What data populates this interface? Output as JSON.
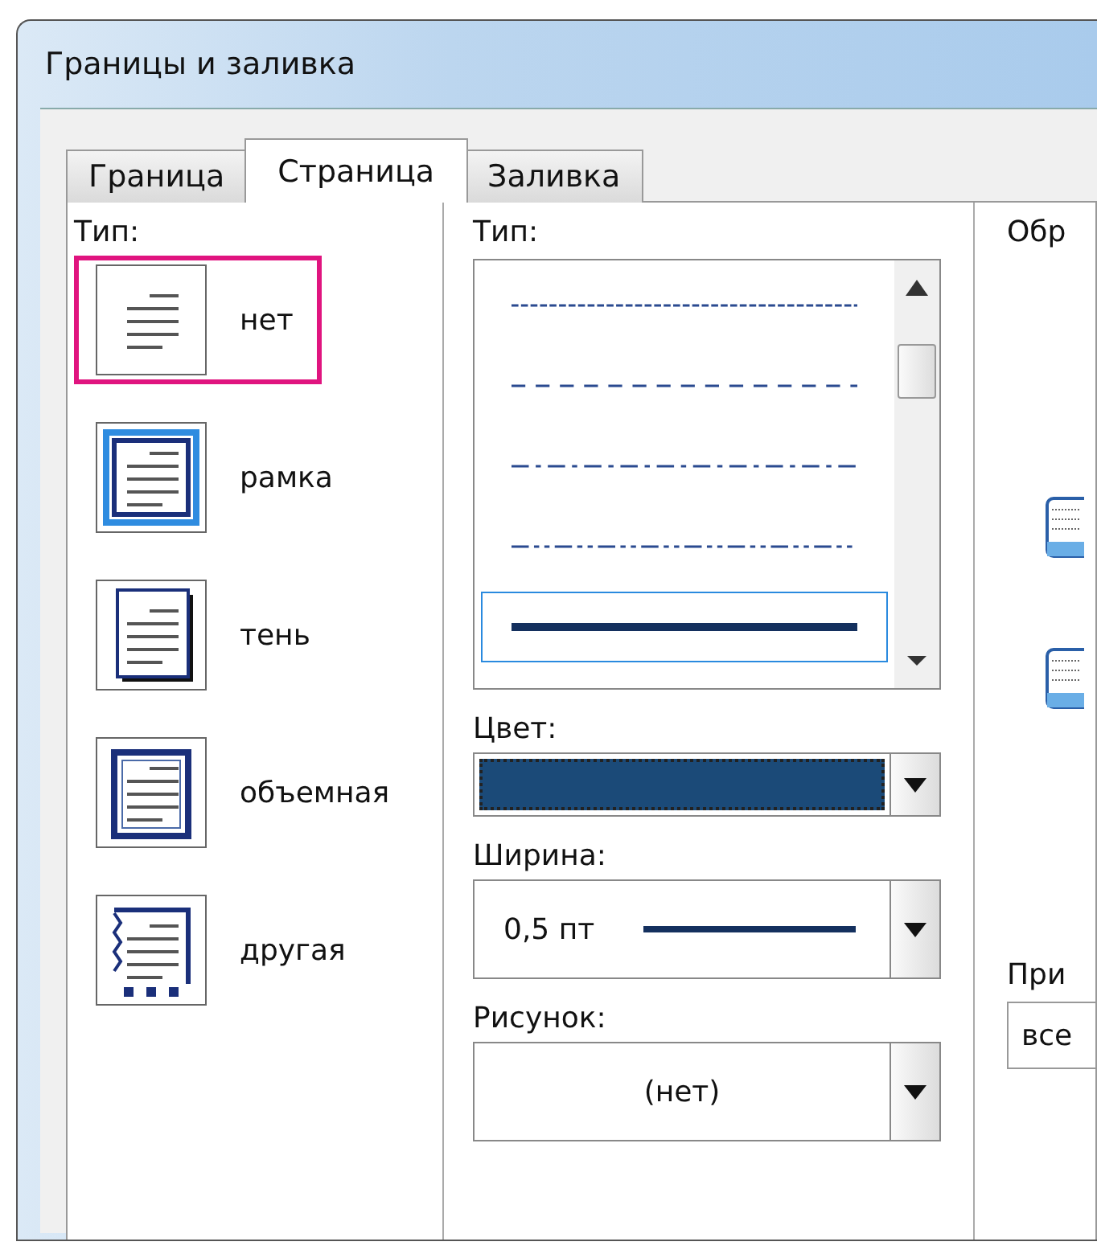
{
  "window": {
    "title": "Границы и заливка"
  },
  "tabs": [
    {
      "label": "Граница",
      "selected": false
    },
    {
      "label": "Страница",
      "selected": true
    },
    {
      "label": "Заливка",
      "selected": false
    }
  ],
  "setting": {
    "label": "Тип:",
    "items": [
      {
        "kind": "none",
        "label": "нет",
        "selected": true
      },
      {
        "kind": "box",
        "label": "рамка",
        "selected": false
      },
      {
        "kind": "shadow",
        "label": "тень",
        "selected": false
      },
      {
        "kind": "threed",
        "label": "объемная",
        "selected": false
      },
      {
        "kind": "custom",
        "label": "другая",
        "selected": false
      }
    ]
  },
  "style": {
    "label": "Тип:",
    "items": [
      {
        "kind": "dense-dash",
        "selected": false
      },
      {
        "kind": "dash",
        "selected": false
      },
      {
        "kind": "dash-dot",
        "selected": false
      },
      {
        "kind": "dash-dot-dot",
        "selected": false
      },
      {
        "kind": "thick",
        "selected": true
      }
    ]
  },
  "color": {
    "label": "Цвет:",
    "color": "#1b4a78"
  },
  "width": {
    "label": "Ширина:",
    "value": "0,5 пт"
  },
  "art": {
    "label": "Рисунок:",
    "value": "(нет)"
  },
  "preview": {
    "label": "Обр"
  },
  "apply_to": {
    "label": "При",
    "value": "все"
  }
}
